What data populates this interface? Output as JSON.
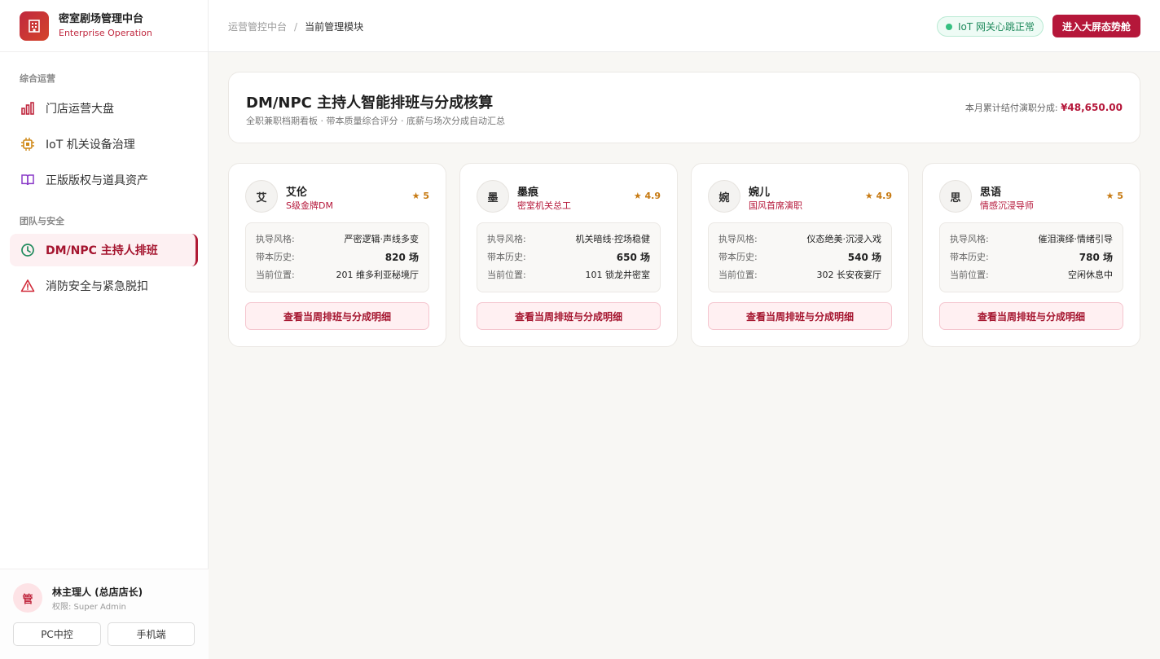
{
  "brand": {
    "title": "密室剧场管理中台",
    "subtitle": "Enterprise Operation"
  },
  "sidebar": {
    "sections": [
      {
        "title": "综合运营"
      },
      {
        "title": "团队与安全"
      }
    ],
    "items": [
      {
        "label": "门店运营大盘",
        "icon": "bar-chart-icon",
        "active": false
      },
      {
        "label": "IoT 机关设备治理",
        "icon": "chip-icon",
        "active": false
      },
      {
        "label": "正版版权与道具资产",
        "icon": "book-icon",
        "active": false
      },
      {
        "label": "DM/NPC 主持人排班",
        "icon": "clock-icon",
        "active": true
      },
      {
        "label": "消防安全与紧急脱扣",
        "icon": "warning-icon",
        "active": false
      }
    ]
  },
  "user": {
    "avatar": "管",
    "name": "林主理人 (总店店长)",
    "role": "权限: Super Admin",
    "modes": [
      "PC中控",
      "手机端"
    ]
  },
  "header": {
    "breadcrumb": [
      "运营管控中台",
      "当前管理模块"
    ],
    "separator": "/",
    "iot_status": "IoT 网关心跳正常",
    "bigscreen": "进入大屏态势舱"
  },
  "main": {
    "title": "DM/NPC 主持人智能排班与分成核算",
    "subtitle": "全职兼职档期看板 · 带本质量综合评分 · 底薪与场次分成自动汇总",
    "settle_label": "本月累计结付演职分成:",
    "settle_value": "¥48,650.00"
  },
  "card_labels": {
    "style": "执导风格:",
    "history": "带本历史:",
    "location": "当前位置:",
    "button": "查看当周排班与分成明细"
  },
  "cards": [
    {
      "avatar": "艾",
      "name": "艾伦",
      "title": "S级金牌DM",
      "rating": "★ 5",
      "style": "严密逻辑·声线多变",
      "history": "820 场",
      "location": "201 维多利亚秘境厅"
    },
    {
      "avatar": "墨",
      "name": "墨痕",
      "title": "密室机关总工",
      "rating": "★ 4.9",
      "style": "机关暗线·控场稳健",
      "history": "650 场",
      "location": "101 锁龙井密室"
    },
    {
      "avatar": "婉",
      "name": "婉儿",
      "title": "国风首席演职",
      "rating": "★ 4.9",
      "style": "仪态绝美·沉浸入戏",
      "history": "540 场",
      "location": "302 长安夜宴厅"
    },
    {
      "avatar": "思",
      "name": "思语",
      "title": "情感沉浸导师",
      "rating": "★ 5",
      "style": "催泪演绎·情绪引导",
      "history": "780 场",
      "location": "空闲休息中"
    }
  ],
  "colors": {
    "accent": "#b5173a",
    "success": "#36c081",
    "rating": "#c77a12"
  }
}
